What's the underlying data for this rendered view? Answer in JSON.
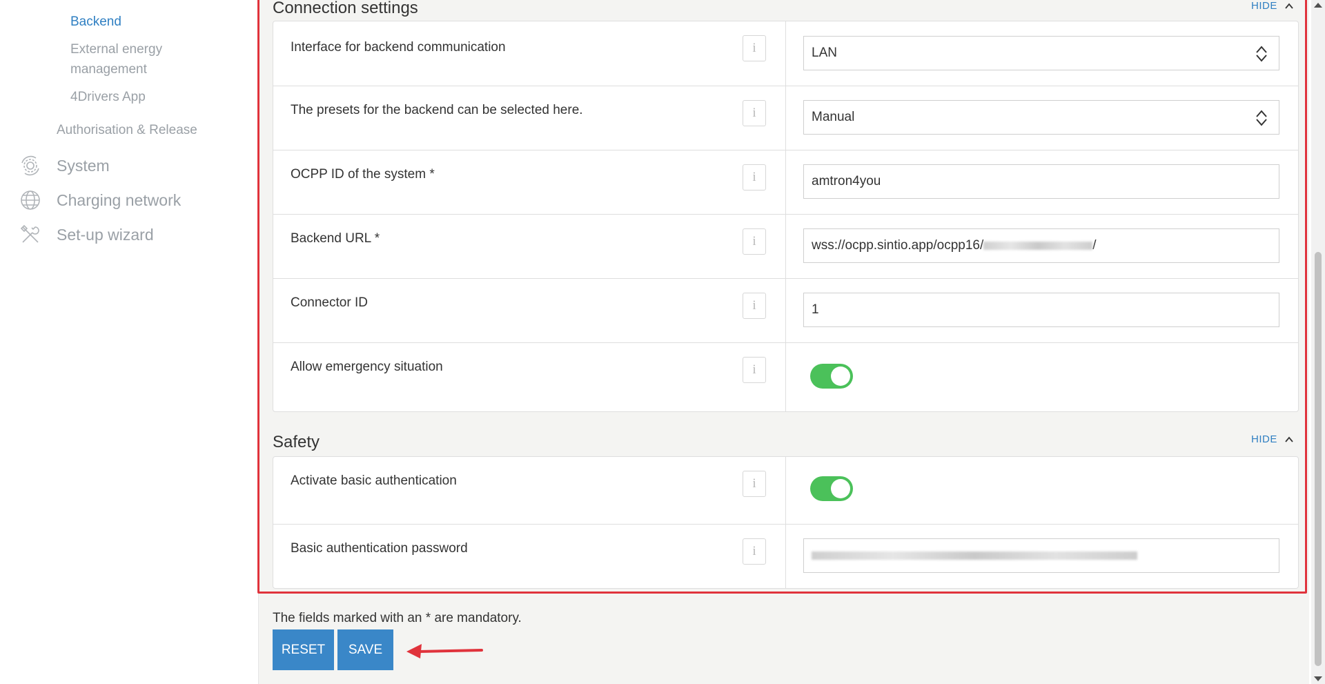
{
  "sidebar": {
    "sub_items": [
      "Backend",
      "External energy",
      "management",
      "4Drivers App"
    ],
    "mid_item": "Authorisation & Release",
    "main_items": [
      {
        "label": "System",
        "icon": "gear-arrows-icon"
      },
      {
        "label": "Charging network",
        "icon": "globe-icon"
      },
      {
        "label": "Set-up wizard",
        "icon": "tools-icon"
      }
    ]
  },
  "connection": {
    "title": "Connection settings",
    "hide": "HIDE",
    "rows": [
      {
        "label": "Interface for backend communication",
        "value": "LAN"
      },
      {
        "label": "The presets for the backend can be selected here.",
        "value": "Manual"
      },
      {
        "label": "OCPP ID of the system *",
        "value": "amtron4you"
      },
      {
        "label": "Backend URL *",
        "value": "wss://ocpp.sintio.app/ocpp16/",
        "value_tail": "/"
      },
      {
        "label": "Connector ID",
        "value": "1"
      },
      {
        "label": "Allow emergency situation",
        "toggle_on": true
      }
    ]
  },
  "safety": {
    "title": "Safety",
    "hide": "HIDE",
    "rows": [
      {
        "label": "Activate basic authentication",
        "toggle_on": true
      },
      {
        "label": "Basic authentication password"
      }
    ]
  },
  "info_glyph": "i",
  "mandatory_note": "The fields marked with an * are mandatory.",
  "buttons": {
    "reset": "RESET",
    "save": "SAVE"
  },
  "colors": {
    "accent": "#3a87c8",
    "toggle_on": "#4bc15a",
    "highlight": "#e0333c",
    "link": "#2f7fc2"
  }
}
